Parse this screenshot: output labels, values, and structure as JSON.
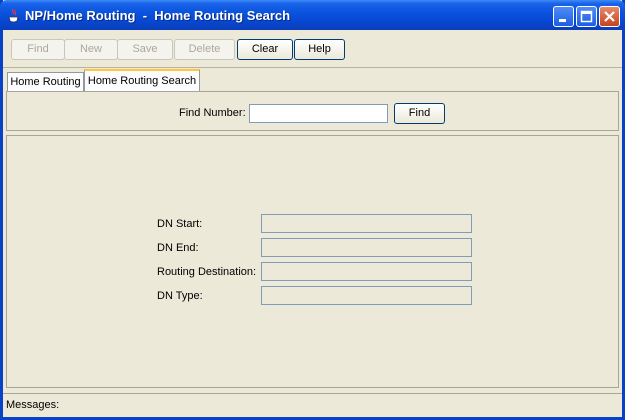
{
  "window": {
    "title": "NP/Home Routing  -  Home Routing Search",
    "icons": [
      "java-icon",
      "minimize-icon",
      "maximize-icon",
      "close-icon"
    ]
  },
  "toolbar": {
    "find_label": "Find",
    "new_label": "New",
    "save_label": "Save",
    "delete_label": "Delete",
    "clear_label": "Clear",
    "help_label": "Help"
  },
  "tabs": [
    {
      "label": "Home Routing",
      "active": false
    },
    {
      "label": "Home Routing Search",
      "active": true
    }
  ],
  "search": {
    "find_number_label": "Find Number:",
    "find_number_value": "",
    "find_button_label": "Find"
  },
  "details": {
    "dn_start_label": "DN Start:",
    "dn_start_value": "",
    "dn_end_label": "DN End:",
    "dn_end_value": "",
    "routing_destination_label": "Routing Destination:",
    "routing_destination_value": "",
    "dn_type_label": "DN Type:",
    "dn_type_value": ""
  },
  "status": {
    "messages_label": "Messages:"
  }
}
